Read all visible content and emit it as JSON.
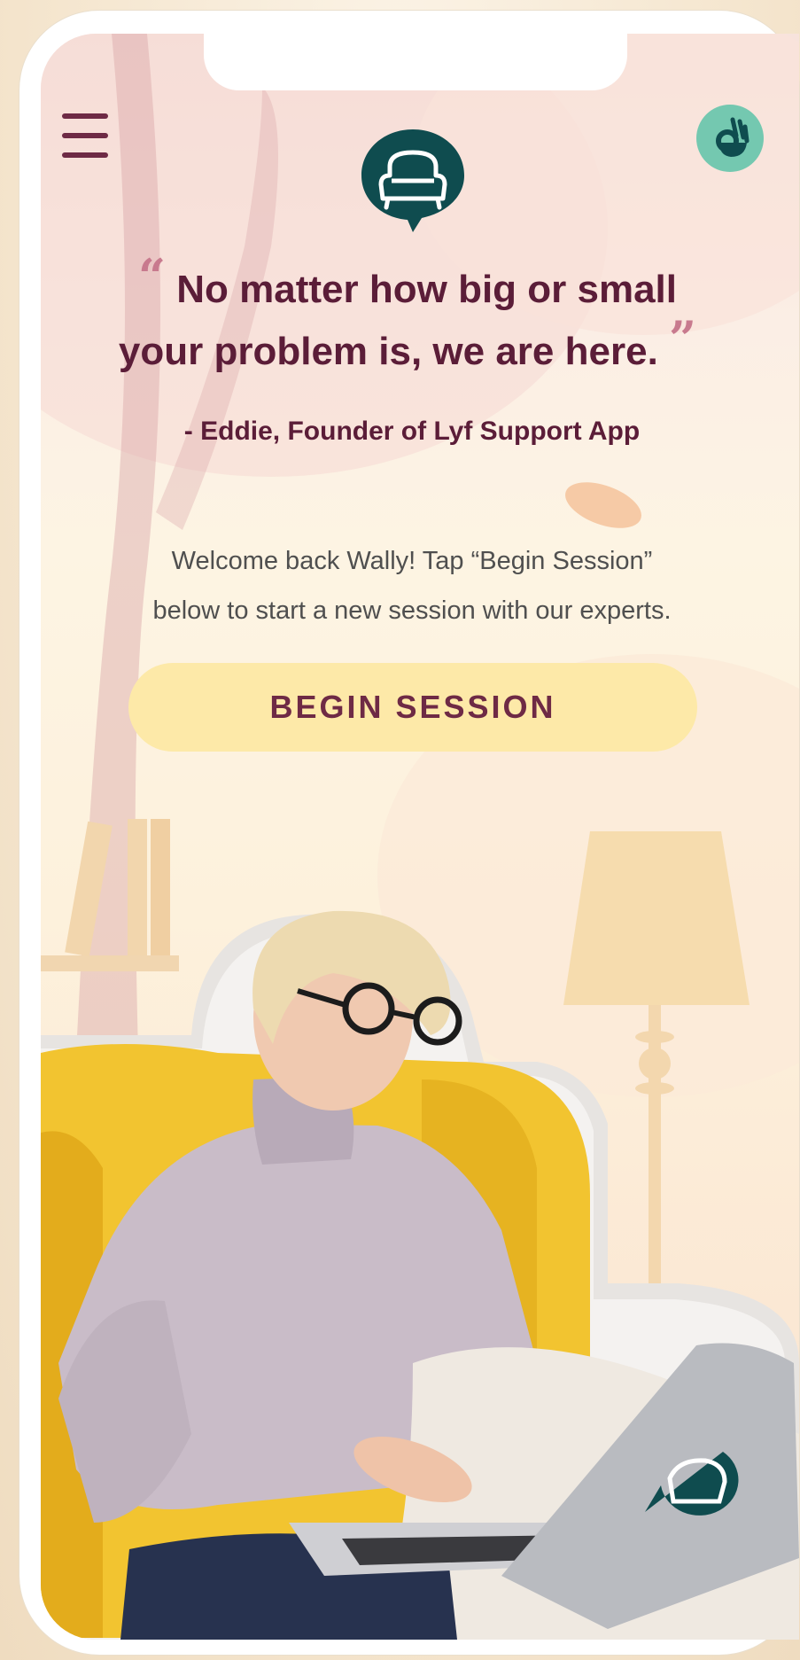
{
  "header": {
    "menu_icon": "hamburger-menu-icon",
    "help_icon": "ok-hand-icon",
    "logo_icon": "armchair-pin-icon"
  },
  "quote": {
    "open_mark": "“",
    "line1": "No matter how big or small",
    "line2": "your problem is, we are here.",
    "close_mark": "”",
    "attribution": "- Eddie, Founder of Lyf Support App"
  },
  "welcome": {
    "line1": "Welcome back Wally! Tap “Begin Session”",
    "line2": "below to start a new session with our experts."
  },
  "cta": {
    "label": "BEGIN SESSION"
  },
  "colors": {
    "primary": "#6e2a45",
    "accent_teal": "#0f4c4f",
    "mint": "#74c8b0",
    "button_bg": "#fde9a8",
    "armchair": "#f2c430"
  }
}
